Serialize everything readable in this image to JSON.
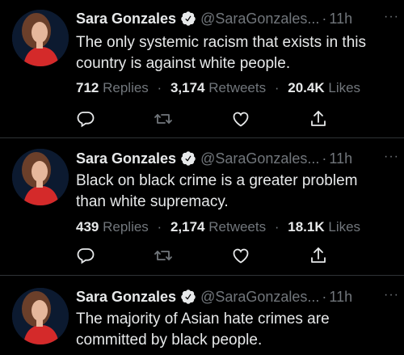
{
  "tweets": [
    {
      "name": "Sara Gonzales",
      "handle": "@SaraGonzales...",
      "separator": "·",
      "time": "11h",
      "more": "···",
      "text": "The only systemic racism that exists in this country is against white people.",
      "replies_count": "712",
      "replies_label": "Replies",
      "retweets_count": "3,174",
      "retweets_label": "Retweets",
      "likes_count": "20.4K",
      "likes_label": "Likes",
      "stat_sep": "·"
    },
    {
      "name": "Sara Gonzales",
      "handle": "@SaraGonzales...",
      "separator": "·",
      "time": "11h",
      "more": "···",
      "text": "Black on black crime is a greater problem than white supremacy.",
      "replies_count": "439",
      "replies_label": "Replies",
      "retweets_count": "2,174",
      "retweets_label": "Retweets",
      "likes_count": "18.1K",
      "likes_label": "Likes",
      "stat_sep": "·"
    },
    {
      "name": "Sara Gonzales",
      "handle": "@SaraGonzales...",
      "separator": "·",
      "time": "11h",
      "more": "···",
      "text": "The majority of Asian hate crimes are committed by black people."
    }
  ],
  "colors": {
    "background": "#000000",
    "text_primary": "#e7e9ea",
    "text_secondary": "#71767b",
    "verified_badge": "#e7e9ea",
    "divider": "#2f3336"
  },
  "icons": {
    "verified": "verified-badge-icon",
    "reply": "reply-icon",
    "retweet": "retweet-icon",
    "like": "heart-icon",
    "share": "share-icon",
    "more": "more-icon"
  }
}
